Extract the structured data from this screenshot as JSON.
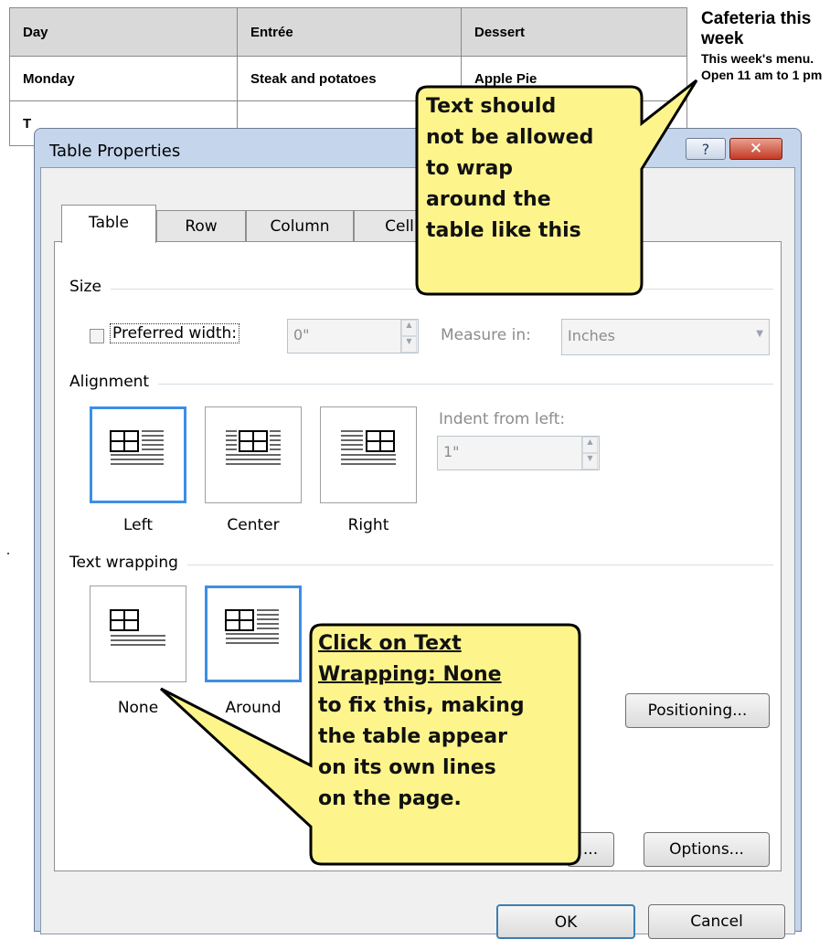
{
  "document": {
    "table": {
      "headers": [
        "Day",
        "Entrée",
        "Dessert"
      ],
      "rows": [
        [
          "Monday",
          "Steak and potatoes",
          "Apple Pie"
        ],
        [
          "T",
          "",
          ""
        ]
      ]
    },
    "side_title": "Cafeteria this week",
    "side_body": "This week's menu. Open 11 am to 1 pm"
  },
  "dialog": {
    "title": "Table Properties",
    "help": "?",
    "close": "✕",
    "tabs": [
      {
        "label": "Table",
        "active": true
      },
      {
        "label": "Row",
        "active": false
      },
      {
        "label": "Column",
        "active": false
      },
      {
        "label": "Cell",
        "active": false
      }
    ],
    "size": {
      "group": "Size",
      "preferred_width_label": "Preferred width:",
      "preferred_width_checked": false,
      "preferred_width_value": "0\"",
      "measure_in_label": "Measure in:",
      "measure_in_value": "Inches"
    },
    "alignment": {
      "group": "Alignment",
      "options": [
        "Left",
        "Center",
        "Right"
      ],
      "selected": "Left",
      "indent_label": "Indent from left:",
      "indent_value": "1\""
    },
    "text_wrapping": {
      "group": "Text wrapping",
      "options": [
        "None",
        "Around"
      ],
      "selected": "Around",
      "positioning_button": "Positioning..."
    },
    "borders_button_tail": "...",
    "options_button": "Options...",
    "ok_button": "OK",
    "cancel_button": "Cancel"
  },
  "callouts": {
    "top": [
      "Text should",
      "not be allowed",
      "to wrap",
      "around the",
      "table like this"
    ],
    "bottom": [
      "Click on Text",
      "Wrapping: None",
      "to fix this, making",
      "the table appear",
      "on its own lines",
      "on the page."
    ]
  },
  "colors": {
    "callout_fill": "#fdf58c",
    "selection_blue": "#3d8ee6",
    "close_red": "#c43a26"
  }
}
